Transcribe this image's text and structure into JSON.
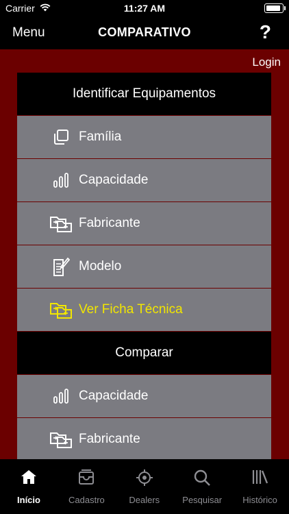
{
  "status": {
    "carrier": "Carrier",
    "time": "11:27 AM"
  },
  "nav": {
    "menu_label": "Menu",
    "title": "COMPARATIVO",
    "help_label": "?"
  },
  "login_label": "Login",
  "sections": [
    {
      "title": "Identificar Equipamentos",
      "items": [
        {
          "label": "Família",
          "icon": "copy-icon"
        },
        {
          "label": "Capacidade",
          "icon": "bars-icon"
        },
        {
          "label": "Fabricante",
          "icon": "folder-transfer-icon"
        },
        {
          "label": "Modelo",
          "icon": "document-edit-icon"
        },
        {
          "label": "Ver Ficha Técnica",
          "icon": "folder-transfer-icon",
          "highlight": true
        }
      ]
    },
    {
      "title": "Comparar",
      "items": [
        {
          "label": "Capacidade",
          "icon": "bars-icon"
        },
        {
          "label": "Fabricante",
          "icon": "folder-transfer-icon"
        }
      ]
    }
  ],
  "tabs": [
    {
      "label": "Início",
      "icon": "home-icon",
      "active": true
    },
    {
      "label": "Cadastro",
      "icon": "inbox-icon"
    },
    {
      "label": "Dealers",
      "icon": "crosshair-icon"
    },
    {
      "label": "Pesquisar",
      "icon": "search-icon"
    },
    {
      "label": "Histórico",
      "icon": "library-icon"
    }
  ],
  "colors": {
    "accent_red": "#6b0000",
    "item_gray": "#7b7b81",
    "highlight_yellow": "#f2e600"
  }
}
